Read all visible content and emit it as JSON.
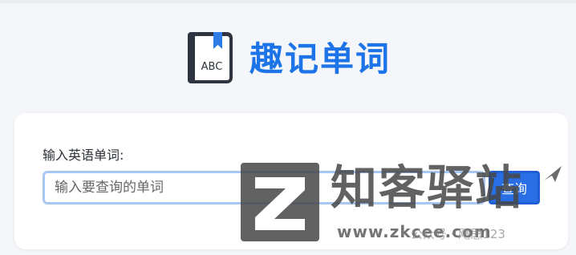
{
  "app": {
    "title": "趣记单词",
    "logo_text": "ABC",
    "brand_color": "#1d74e8"
  },
  "form": {
    "label": "输入英语单词:",
    "input_value": "",
    "input_placeholder": "输入要查询的单词",
    "search_button_label": "查询"
  },
  "watermark": {
    "brand": "知客驿站",
    "url": "www.zkcee.com",
    "credit": "公众号 · 飕思123",
    "color": "#464646"
  }
}
